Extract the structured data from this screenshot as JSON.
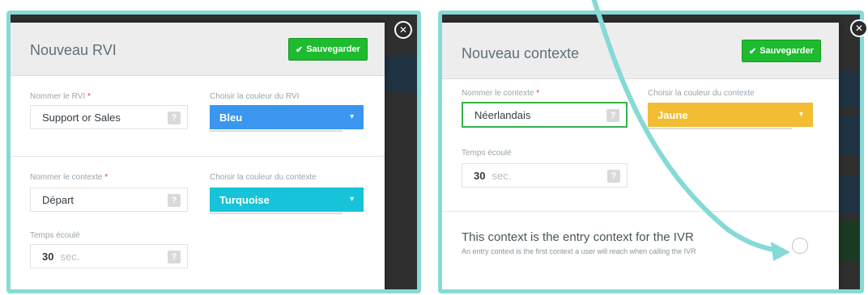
{
  "left": {
    "title": "Nouveau RVI",
    "save_label": "Sauvegarder",
    "ivr_name_label": "Nommer le RVI",
    "ivr_name_value": "Support or Sales",
    "ivr_color_label": "Choisir la couleur du RVI",
    "ivr_color_value": "Bleu",
    "ivr_color_hex": "#3a96ef",
    "context_name_label": "Nommer le contexte",
    "context_name_value": "Départ",
    "context_color_label": "Choisir la couleur du contexte",
    "context_color_value": "Turquoise",
    "context_color_hex": "#17c3d8",
    "elapsed_label": "Temps écoulé",
    "elapsed_value": "30",
    "elapsed_unit": "sec.",
    "required_mark": "*",
    "help_glyph": "?"
  },
  "right": {
    "title": "Nouveau contexte",
    "save_label": "Sauvegarder",
    "context_name_label": "Nommer le contexte",
    "context_name_value": "Néerlandais",
    "context_color_label": "Choisir la couleur du contexte",
    "context_color_value": "Jaune",
    "context_color_hex": "#f2bd32",
    "elapsed_label": "Temps écoulé",
    "elapsed_value": "30",
    "elapsed_unit": "sec.",
    "entry_title": "This context is the entry context for the IVR",
    "entry_description": "An entry context is the first context a user will reach when calling the IVR",
    "required_mark": "*",
    "help_glyph": "?"
  },
  "colors": {
    "accent_frame": "#86dad6",
    "save_green": "#1dbb2e",
    "focus_green": "#33b34a"
  },
  "icons": {
    "save": "check-icon",
    "close": "close-icon",
    "select": "caret-down-icon",
    "help": "help-icon"
  }
}
